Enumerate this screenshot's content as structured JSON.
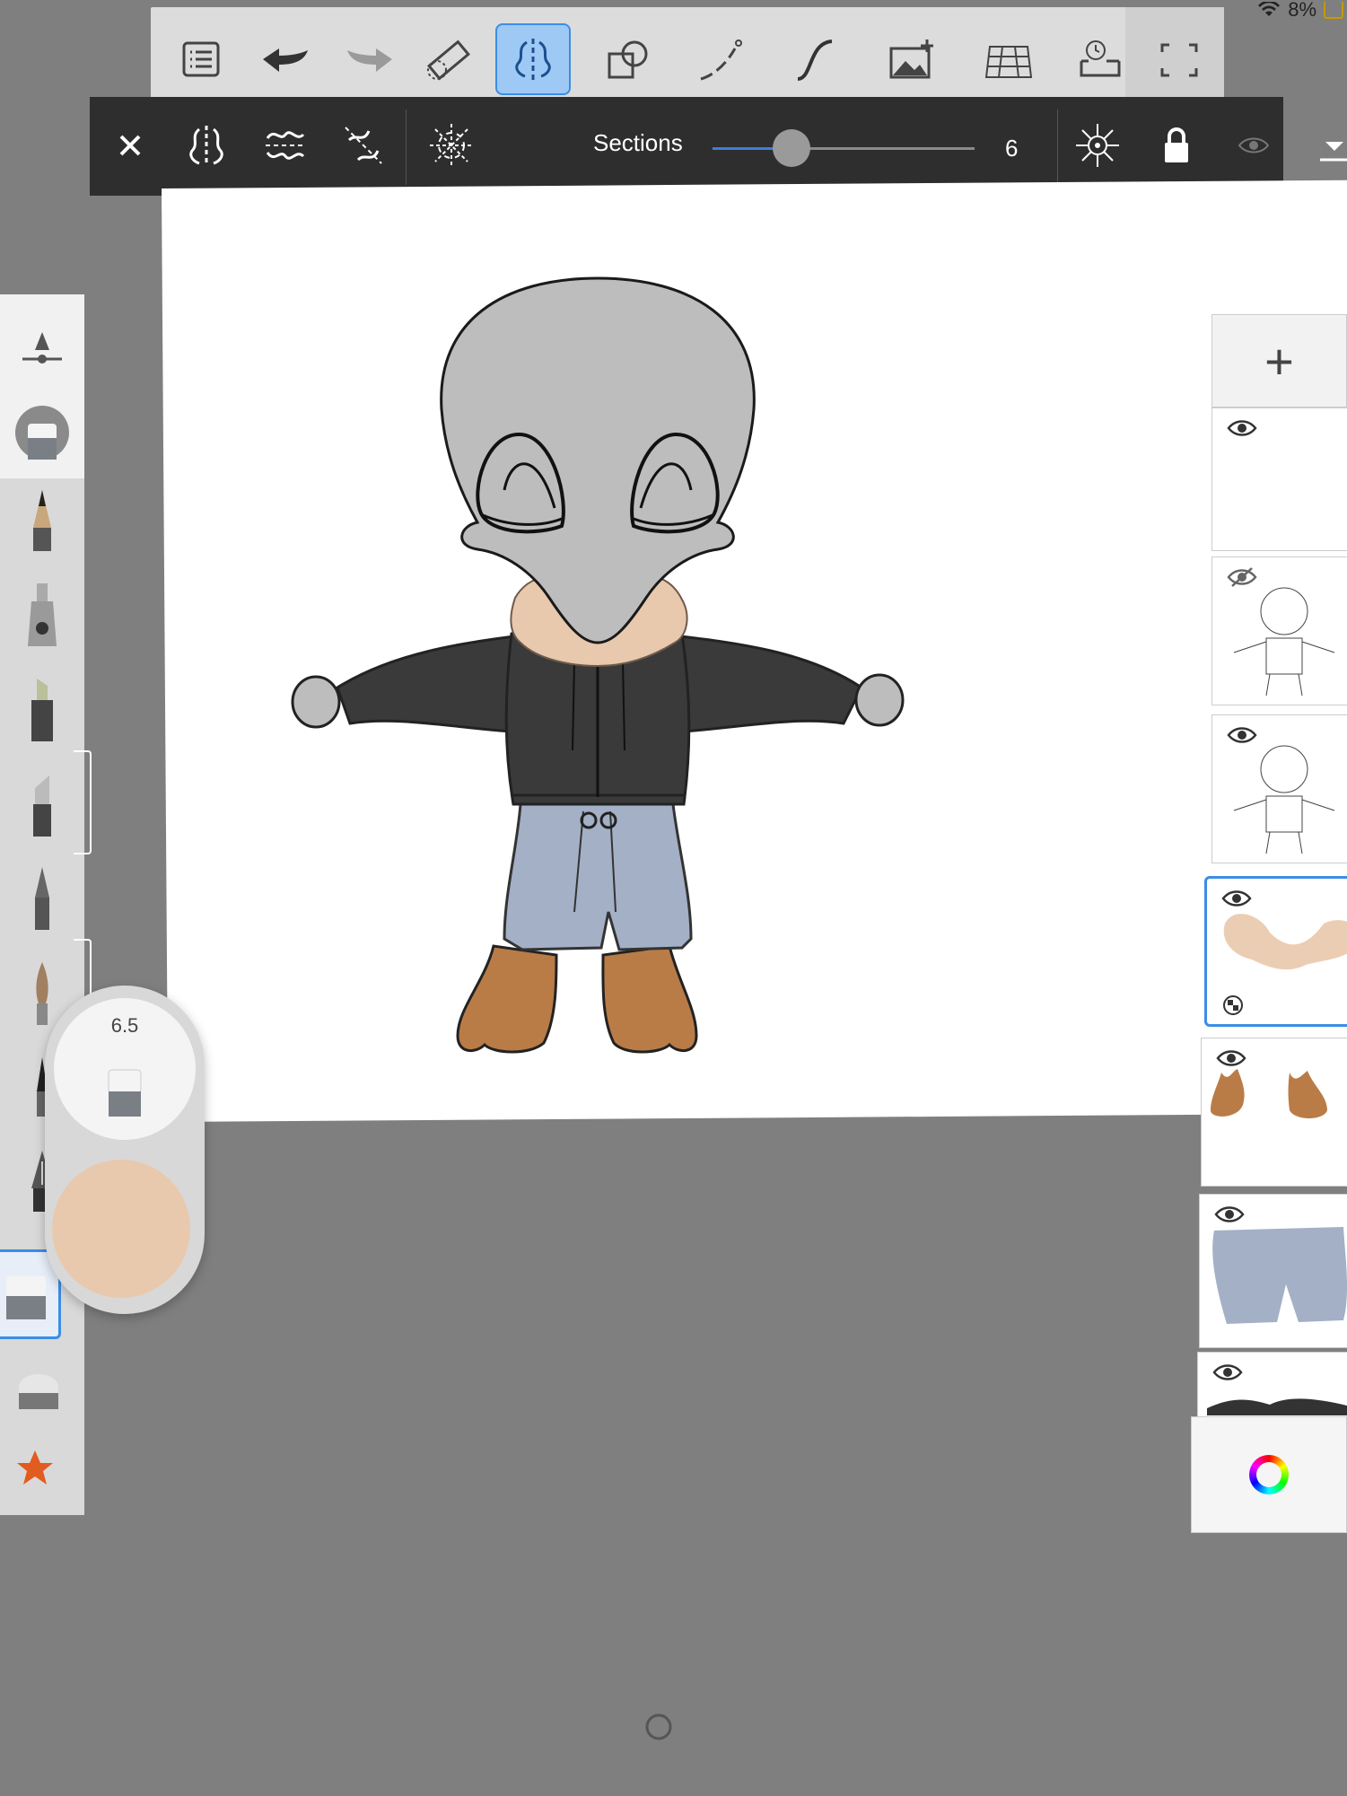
{
  "status": {
    "battery": "8%"
  },
  "toolbar": {
    "items": [
      "list",
      "undo",
      "redo",
      "ruler",
      "symmetry",
      "shapes",
      "line",
      "curve",
      "image",
      "perspective",
      "time-lapse",
      "fullscreen"
    ],
    "active": "symmetry"
  },
  "symmetry_bar": {
    "sections_label": "Sections",
    "sections_value": "6",
    "sections_fraction": 0.3,
    "modes": [
      "close",
      "mirror",
      "wave",
      "radial-lines",
      "radial"
    ],
    "right_tools": [
      "center",
      "lock",
      "visibility",
      "collapse"
    ]
  },
  "brush_puck": {
    "size": "6.5",
    "color": "#e8c9ad"
  },
  "brushes": [
    "opacity-slider",
    "eraser",
    "pencil",
    "airbrush",
    "marker",
    "chisel",
    "ink-pen",
    "paint-brush",
    "fine-pen",
    "fountain-pen",
    "eraser-hard",
    "eraser-soft",
    "favorite-star"
  ],
  "layers": [
    {
      "name": "empty-layer",
      "visible": true
    },
    {
      "name": "sketch-layer-1",
      "visible": false
    },
    {
      "name": "sketch-layer-2",
      "visible": true
    },
    {
      "name": "skin-layer",
      "visible": true,
      "selected": true
    },
    {
      "name": "boots-layer",
      "visible": true
    },
    {
      "name": "jeans-layer",
      "visible": true
    },
    {
      "name": "partial-layer",
      "visible": true
    }
  ],
  "colors": {
    "accent": "#3a8ee6",
    "skin": "#e8c9ad",
    "head": "#bdbdbd",
    "hoodie": "#3a3a3a",
    "jeans": "#a3b0c6",
    "boots": "#b97c47"
  }
}
